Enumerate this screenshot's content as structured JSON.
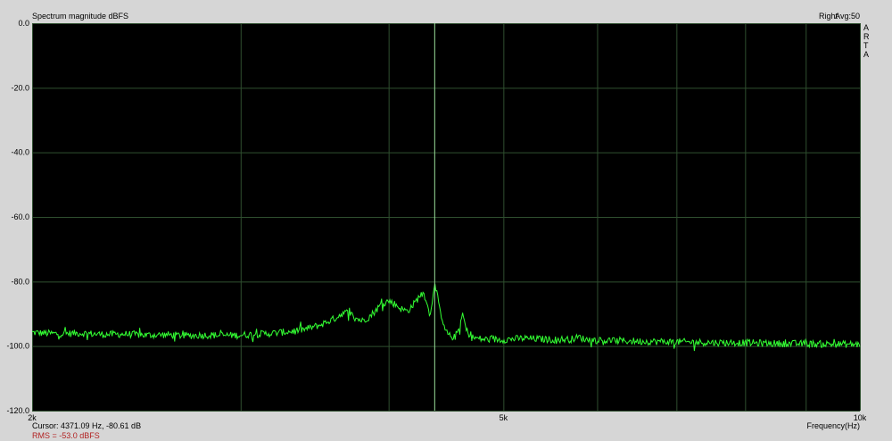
{
  "app": {
    "logo_text": "ARTA"
  },
  "chart_data": {
    "type": "line",
    "title": "Spectrum magnitude dBFS",
    "channel_label": "Right",
    "avg_label": "Avg:50",
    "xlabel": "Frequency(Hz)",
    "ylabel": "",
    "x_scale": "log",
    "xlim": [
      2000,
      10000
    ],
    "ylim": [
      -120,
      0
    ],
    "y_ticks": [
      0,
      -20,
      -40,
      -60,
      -80,
      -100,
      -120
    ],
    "y_tick_labels": [
      "0.0",
      "-20.0",
      "-40.0",
      "-60.0",
      "-80.0",
      "-100.0",
      "-120.0"
    ],
    "x_tick_labels": [
      {
        "value": 2000,
        "label": "2k"
      },
      {
        "value": 5000,
        "label": "5k"
      },
      {
        "value": 10000,
        "label": "10k"
      }
    ],
    "x_gridlines": [
      2000,
      3000,
      4000,
      5000,
      6000,
      7000,
      8000,
      9000,
      10000
    ],
    "grid": true,
    "cursor": {
      "freq": 4371.09,
      "db": -80.61,
      "text": "Cursor: 4371.09 Hz, -80.61 dB"
    },
    "rms_text": "RMS =  -53.0 dBFS",
    "series": [
      {
        "color": "#33ff33",
        "points": [
          [
            2000,
            -95.8
          ],
          [
            2100,
            -96.2
          ],
          [
            2200,
            -96.0
          ],
          [
            2300,
            -96.4
          ],
          [
            2400,
            -96.3
          ],
          [
            2500,
            -96.6
          ],
          [
            2600,
            -96.5
          ],
          [
            2700,
            -96.8
          ],
          [
            2800,
            -96.6
          ],
          [
            2900,
            -96.7
          ],
          [
            3000,
            -96.6
          ],
          [
            3100,
            -96.3
          ],
          [
            3200,
            -96.0
          ],
          [
            3300,
            -95.5
          ],
          [
            3400,
            -94.8
          ],
          [
            3500,
            -93.5
          ],
          [
            3600,
            -91.5
          ],
          [
            3650,
            -90.0
          ],
          [
            3700,
            -89.5
          ],
          [
            3750,
            -91.2
          ],
          [
            3800,
            -92.2
          ],
          [
            3850,
            -91.0
          ],
          [
            3900,
            -89.0
          ],
          [
            3950,
            -86.8
          ],
          [
            4000,
            -86.0
          ],
          [
            4050,
            -87.0
          ],
          [
            4100,
            -88.5
          ],
          [
            4150,
            -89.2
          ],
          [
            4200,
            -87.0
          ],
          [
            4250,
            -84.5
          ],
          [
            4280,
            -83.6
          ],
          [
            4310,
            -86.0
          ],
          [
            4330,
            -91.0
          ],
          [
            4350,
            -87.0
          ],
          [
            4371.09,
            -80.61
          ],
          [
            4400,
            -85.0
          ],
          [
            4430,
            -91.0
          ],
          [
            4460,
            -95.0
          ],
          [
            4500,
            -96.8
          ],
          [
            4550,
            -97.3
          ],
          [
            4600,
            -93.5
          ],
          [
            4620,
            -89.8
          ],
          [
            4650,
            -95.0
          ],
          [
            4700,
            -97.3
          ],
          [
            4800,
            -97.9
          ],
          [
            5000,
            -98.0
          ],
          [
            5200,
            -97.6
          ],
          [
            5500,
            -98.0
          ],
          [
            5700,
            -97.9
          ],
          [
            5800,
            -97.2
          ],
          [
            5850,
            -97.9
          ],
          [
            6000,
            -98.2
          ],
          [
            6500,
            -98.5
          ],
          [
            7000,
            -98.7
          ],
          [
            7500,
            -98.9
          ],
          [
            8000,
            -99.0
          ],
          [
            8500,
            -99.2
          ],
          [
            9000,
            -99.3
          ],
          [
            9500,
            -99.4
          ],
          [
            10000,
            -99.5
          ]
        ]
      }
    ]
  }
}
